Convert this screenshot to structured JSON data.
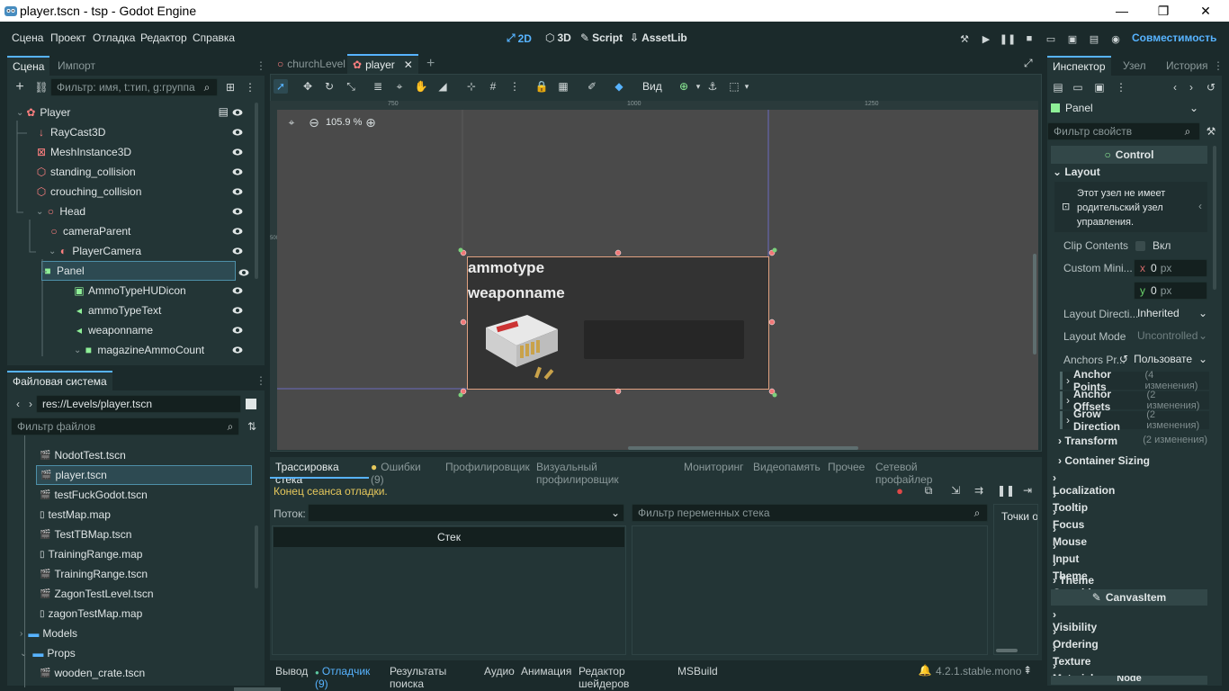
{
  "window": {
    "title": "player.tscn - tsp - Godot Engine",
    "minimize": "—",
    "maximize": "❐",
    "close": "✕"
  },
  "menu": [
    "Сцена",
    "Проект",
    "Отладка",
    "Редактор",
    "Справка"
  ],
  "modes": {
    "two_d": "2D",
    "three_d": "3D",
    "script": "Script",
    "assetlib": "AssetLib"
  },
  "renderer": "Совместимость",
  "scene_dock": {
    "tabs": [
      "Сцена",
      "Импорт"
    ],
    "filter_placeholder": "Фильтр: имя, t:тип, g:группа",
    "nodes": [
      {
        "label": "Player",
        "icon": "player-icon",
        "color": "#fc7f7f"
      },
      {
        "label": "RayCast3D",
        "icon": "raycast-icon",
        "color": "#fc7f7f"
      },
      {
        "label": "MeshInstance3D",
        "icon": "mesh-icon",
        "color": "#fc7f7f"
      },
      {
        "label": "standing_collision",
        "icon": "collision-icon",
        "color": "#fc7f7f"
      },
      {
        "label": "crouching_collision",
        "icon": "collision-icon",
        "color": "#fc7f7f"
      },
      {
        "label": "Head",
        "icon": "node3d-icon",
        "color": "#fc7f7f"
      },
      {
        "label": "cameraParent",
        "icon": "node3d-icon",
        "color": "#fc7f7f"
      },
      {
        "label": "PlayerCamera",
        "icon": "camera-icon",
        "color": "#fc7f7f"
      },
      {
        "label": "Panel",
        "icon": "panel-icon",
        "color": "#8eef97"
      },
      {
        "label": "AmmoTypeHUDicon",
        "icon": "texture-rect-icon",
        "color": "#8eef97"
      },
      {
        "label": "ammoTypeText",
        "icon": "label-icon",
        "color": "#8eef97"
      },
      {
        "label": "weaponname",
        "icon": "label-icon",
        "color": "#8eef97"
      },
      {
        "label": "magazineAmmoCount",
        "icon": "panel-icon",
        "color": "#8eef97"
      }
    ]
  },
  "filesystem": {
    "tab": "Файловая система",
    "path": "res://Levels/player.tscn",
    "filter_placeholder": "Фильтр файлов",
    "files": [
      {
        "label": "NodotTest.tscn",
        "type": "scene"
      },
      {
        "label": "player.tscn",
        "type": "scene"
      },
      {
        "label": "testFuckGodot.tscn",
        "type": "scene"
      },
      {
        "label": "testMap.map",
        "type": "file"
      },
      {
        "label": "TestTBMap.tscn",
        "type": "scene"
      },
      {
        "label": "TrainingRange.map",
        "type": "file"
      },
      {
        "label": "TrainingRange.tscn",
        "type": "scene"
      },
      {
        "label": "ZagonTestLevel.tscn",
        "type": "scene"
      },
      {
        "label": "zagonTestMap.map",
        "type": "file"
      },
      {
        "label": "Models",
        "type": "folder"
      },
      {
        "label": "Props",
        "type": "folder"
      },
      {
        "label": "wooden_crate.tscn",
        "type": "scene"
      }
    ]
  },
  "editor_tabs": [
    {
      "label": "churchLevel"
    },
    {
      "label": "player"
    }
  ],
  "toolbar": {
    "view": "Вид"
  },
  "viewport": {
    "zoom": "105.9 %",
    "ruler": [
      "750",
      "1000",
      "1250"
    ],
    "ruler_side": "500",
    "panel_text": [
      "ammotype",
      "weaponname"
    ]
  },
  "debugger": {
    "tabs": [
      "Трассировка стека",
      "Ошибки (9)",
      "Профилировщик",
      "Визуальный профилировщик",
      "Мониторинг",
      "Видеопамять",
      "Прочее",
      "Сетевой профайлер"
    ],
    "status": "Конец сеанса отладки.",
    "thread_label": "Поток:",
    "stack_header": "Стек",
    "var_filter_placeholder": "Фильтр переменных стека",
    "breakpoints": "Точки ос"
  },
  "bottom_bar": {
    "tabs": [
      "Вывод",
      "Отладчик (9)",
      "Результаты поиска",
      "Аудио",
      "Анимация",
      "Редактор шейдеров",
      "MSBuild"
    ],
    "version": "4.2.1.stable.mono"
  },
  "inspector": {
    "tabs": [
      "Инспектор",
      "Узел",
      "История"
    ],
    "node": "Panel",
    "filter_placeholder": "Фильтр свойств",
    "class": "Control",
    "layout": "Layout",
    "warning": "Этот узел не имеет родительский узел управления.",
    "clip_contents": {
      "label": "Clip Contents",
      "value": "Вкл"
    },
    "custom_min": {
      "label": "Custom Mini...",
      "x": "0",
      "y": "0",
      "unit": "px",
      "x_label": "x",
      "y_label": "y"
    },
    "layout_direction": {
      "label": "Layout Directi...",
      "value": "Inherited"
    },
    "layout_mode": {
      "label": "Layout Mode",
      "value": "Uncontrolled"
    },
    "anchors_preset": {
      "label": "Anchors Pr...",
      "value": "Пользовате"
    },
    "subsections": [
      {
        "label": "Anchor Points",
        "changes": "(4 изменения)"
      },
      {
        "label": "Anchor Offsets",
        "changes": "(2 изменения)"
      },
      {
        "label": "Grow Direction",
        "changes": "(2 изменения)"
      }
    ],
    "transform": {
      "label": "Transform",
      "changes": "(2 изменения)"
    },
    "container_sizing": "Container Sizing",
    "sections": [
      "Localization",
      "Tooltip",
      "Focus",
      "Mouse",
      "Input",
      "Theme",
      "Theme Overrides"
    ],
    "canvas_item": "CanvasItem",
    "canvas_sections": [
      "Visibility",
      "Ordering",
      "Texture",
      "Material"
    ],
    "node_footer": "Node"
  },
  "colors": {
    "accent": "#57b3ff",
    "bg": "#1b2a2b",
    "panel": "#233536",
    "selection": "#e0a080"
  }
}
